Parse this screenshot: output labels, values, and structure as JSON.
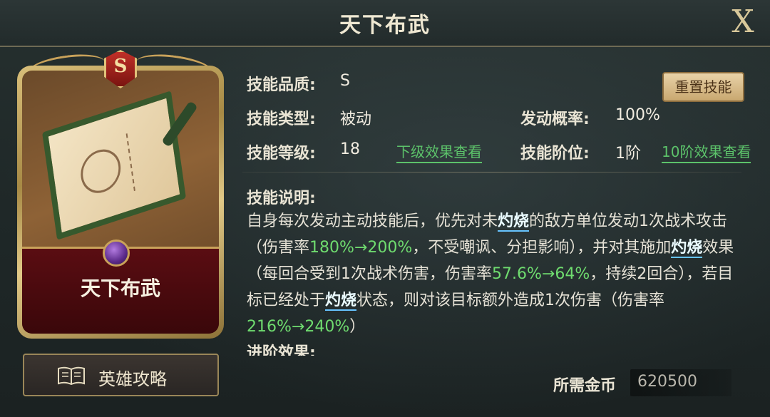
{
  "header": {
    "title": "天下布武",
    "close_label": "X"
  },
  "card": {
    "name": "天下布武",
    "quality_badge": "S"
  },
  "guide_button": {
    "label": "英雄攻略",
    "icon": "book-icon"
  },
  "info": {
    "quality_label": "技能品质:",
    "quality_value": "S",
    "type_label": "技能类型:",
    "type_value": "被动",
    "rate_label": "发动概率:",
    "rate_value": "100%",
    "level_label": "技能等级:",
    "level_value": "18",
    "next_level_link": "下级效果查看",
    "rank_label": "技能阶位:",
    "rank_value": "1阶",
    "rank10_link": "10阶效果查看",
    "reset_button": "重置技能"
  },
  "description": {
    "label": "技能说明:",
    "parts": [
      {
        "text": "自身每次发动主动技能后，优先对未",
        "style": "normal"
      },
      {
        "text": "灼烧",
        "style": "highlight"
      },
      {
        "text": "的敌方单位发动1次战术攻击（伤害率",
        "style": "normal"
      },
      {
        "text": "180%→200%",
        "style": "number"
      },
      {
        "text": "，不受嘲讽、分担影响），并对其施加",
        "style": "normal"
      },
      {
        "text": "灼烧",
        "style": "highlight"
      },
      {
        "text": "效果（每回合受到1次战术伤害，伤害率",
        "style": "normal"
      },
      {
        "text": "57.6%→64%",
        "style": "number"
      },
      {
        "text": "，持续2回合），若目标已经处于",
        "style": "normal"
      },
      {
        "text": "灼烧",
        "style": "highlight"
      },
      {
        "text": "状态，则对该目标额外造成1次伤害（伤害率",
        "style": "normal"
      },
      {
        "text": "216%→240%",
        "style": "number"
      },
      {
        "text": "）",
        "style": "normal"
      }
    ],
    "advanced_label": "进阶效果:"
  },
  "cost": {
    "label": "所需金币",
    "value": "620500"
  },
  "colors": {
    "highlight_number": "#6fdc6f",
    "link": "#5cc26a",
    "keyword_underline": "#67c4ff"
  }
}
